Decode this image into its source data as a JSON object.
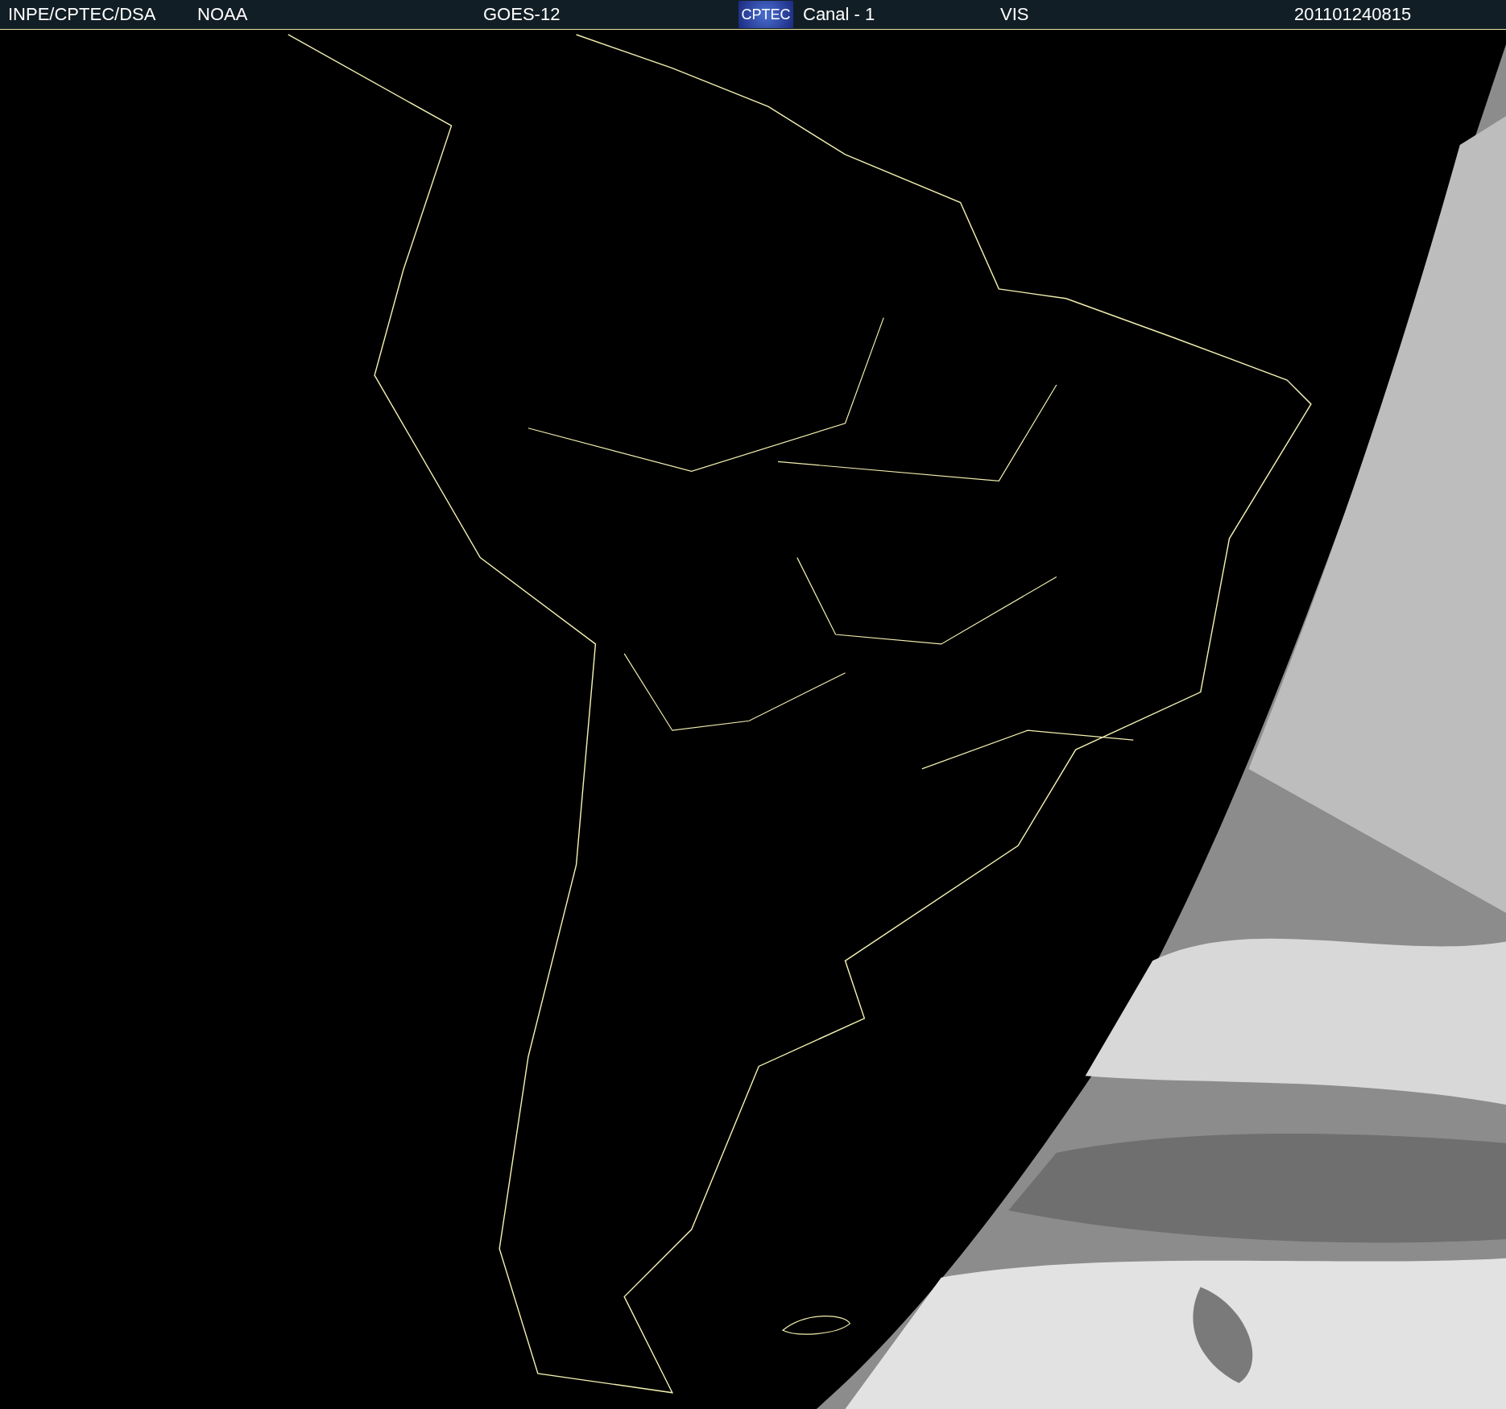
{
  "header": {
    "items": [
      {
        "kind": "text",
        "text": "INPE/CPTEC/DSA"
      },
      {
        "kind": "text",
        "text": "NOAA"
      },
      {
        "kind": "text",
        "text": "GOES-12"
      },
      {
        "kind": "logo",
        "text": "CPTEC"
      },
      {
        "kind": "text",
        "text": "Canal - 1"
      },
      {
        "kind": "text",
        "text": "VIS"
      },
      {
        "kind": "text",
        "text": "201101240815"
      }
    ]
  }
}
